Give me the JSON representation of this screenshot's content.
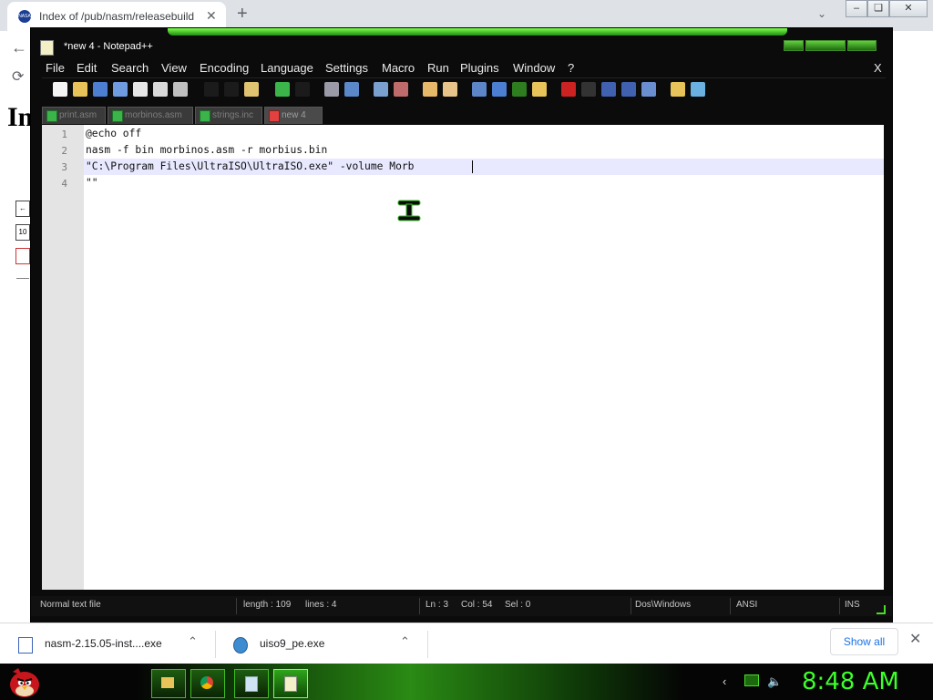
{
  "browser": {
    "tab_title": "Index of /pub/nasm/releasebuild",
    "tab_close": "✕",
    "new_tab": "+",
    "page_heading": "In"
  },
  "notepad": {
    "window_title": "*new  4 - Notepad++",
    "menu": [
      "File",
      "Edit",
      "Search",
      "View",
      "Encoding",
      "Language",
      "Settings",
      "Macro",
      "Run",
      "Plugins",
      "Window",
      "?"
    ],
    "close_label": "X",
    "tabs": [
      {
        "label": "print.asm"
      },
      {
        "label": "morbinos.asm"
      },
      {
        "label": "strings.inc"
      },
      {
        "label": "new  4"
      }
    ],
    "lines": [
      {
        "num": "1",
        "text": "@echo off"
      },
      {
        "num": "2",
        "text": "nasm -f bin morbinos.asm -r morbius.bin"
      },
      {
        "num": "3",
        "text": "\"C:\\Program Files\\UltraISO\\UltraISO.exe\" -volume Morb"
      },
      {
        "num": "4",
        "text": "\"\""
      }
    ],
    "status": {
      "filetype": "Normal text file",
      "length": "length : 109",
      "lines": "lines : 4",
      "ln": "Ln : 3",
      "col": "Col : 54",
      "sel": "Sel : 0",
      "eol": "Dos\\Windows",
      "encoding": "ANSI",
      "mode": "INS"
    }
  },
  "downloads": {
    "items": [
      {
        "name": "nasm-2.15.05-inst....exe"
      },
      {
        "name": "uiso9_pe.exe"
      }
    ],
    "show_all": "Show all",
    "close": "✕"
  },
  "taskbar": {
    "clock": "8:48 AM"
  },
  "colors": {
    "accent_green": "#3cff2a",
    "editor_current_line": "#e8e8ff",
    "link_blue": "#1a73e8"
  }
}
